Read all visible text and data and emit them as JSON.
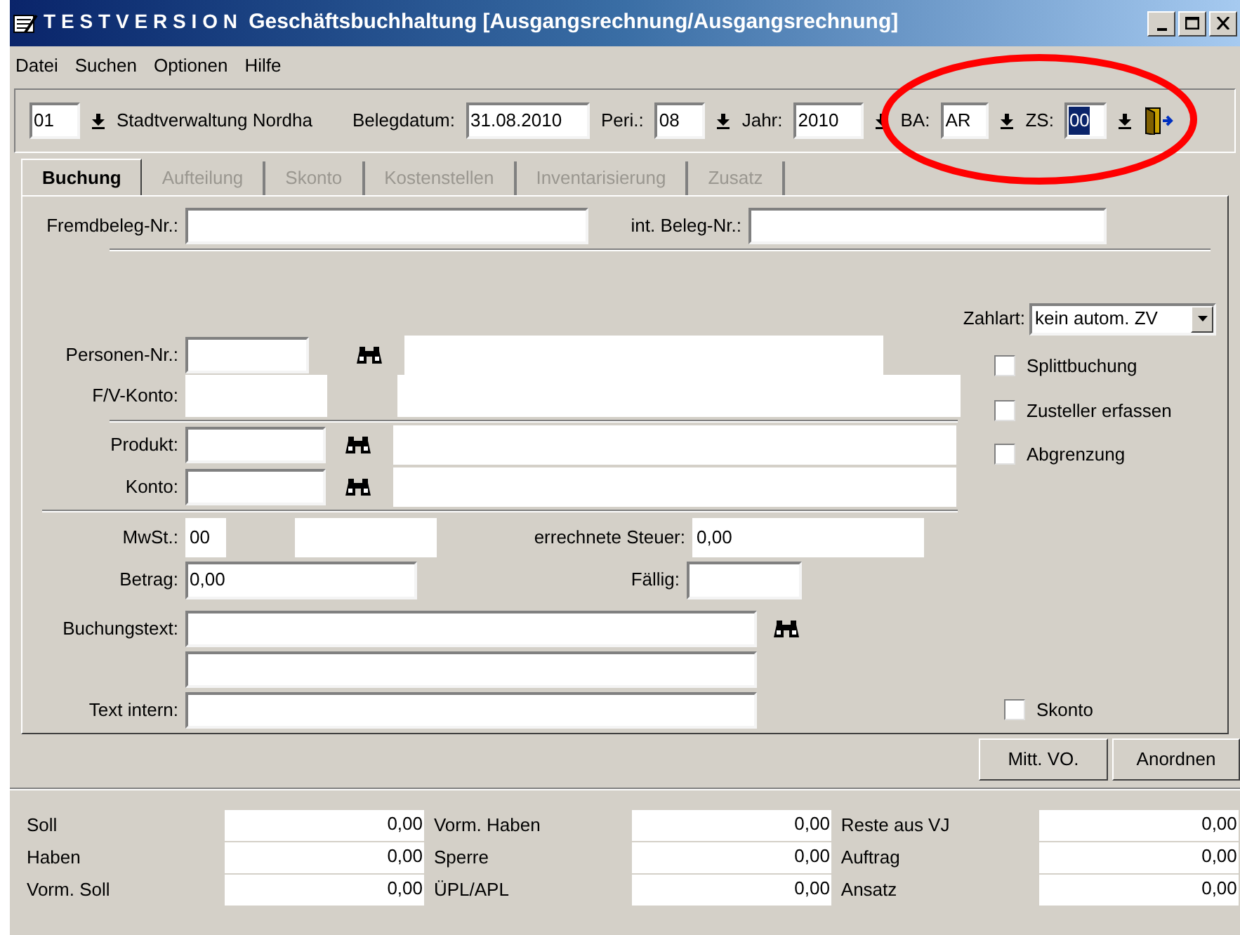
{
  "window": {
    "brand": "TESTVERSION",
    "title": "Geschäftsbuchhaltung [Ausgangsrechnung/Ausgangsrechnung]"
  },
  "menu": [
    "Datei",
    "Suchen",
    "Optionen",
    "Hilfe"
  ],
  "toolbar": {
    "mandant": "01",
    "mandant_name": "Stadtverwaltung Nordha",
    "fields": [
      {
        "label": "Belegdatum:",
        "value": "31.08.2010",
        "arrow": false,
        "focused": false
      },
      {
        "label": "Peri.:",
        "value": "08",
        "arrow": true,
        "focused": false
      },
      {
        "label": "Jahr:",
        "value": "2010",
        "arrow": true,
        "focused": false
      },
      {
        "label": "BA:",
        "value": "AR",
        "arrow": true,
        "focused": false
      },
      {
        "label": "ZS:",
        "value": "00",
        "arrow": true,
        "focused": true
      }
    ]
  },
  "annotation": {
    "kind": "ellipse",
    "color": "#ff0000"
  },
  "tabs": [
    {
      "label": "Buchung",
      "selected": true,
      "disabled": false
    },
    {
      "label": "Aufteilung",
      "selected": false,
      "disabled": true
    },
    {
      "label": "Skonto",
      "selected": false,
      "disabled": true
    },
    {
      "label": "Kostenstellen",
      "selected": false,
      "disabled": true
    },
    {
      "label": "Inventarisierung",
      "selected": false,
      "disabled": true
    },
    {
      "label": "Zusatz",
      "selected": false,
      "disabled": true
    }
  ],
  "form": {
    "fremdbeleg": {
      "label": "Fremdbeleg-Nr.:",
      "kind": "edit"
    },
    "int_beleg": {
      "label": "int. Beleg-Nr.:",
      "kind": "edit"
    },
    "zahlart": {
      "label": "Zahlart:",
      "value": "kein autom. ZV"
    },
    "personen": {
      "label": "Personen-Nr.:",
      "kind": "edit"
    },
    "fv_konto": {
      "label": "F/V-Konto:",
      "kind": "readonly"
    },
    "produkt": {
      "label": "Produkt:",
      "kind": "edit"
    },
    "konto": {
      "label": "Konto:",
      "kind": "edit"
    },
    "mwst": {
      "label": "MwSt.:",
      "value": "00",
      "kind": "readonly"
    },
    "steuer": {
      "label": "errechnete Steuer:",
      "value": "0,00",
      "kind": "readonly"
    },
    "betrag": {
      "label": "Betrag:",
      "value": "0,00",
      "kind": "edit"
    },
    "faellig": {
      "label": "Fällig:",
      "kind": "edit"
    },
    "buchungstext": {
      "label": "Buchungstext:",
      "kind": "edit"
    },
    "text_intern": {
      "label": "Text intern:",
      "kind": "edit"
    }
  },
  "checkboxes": [
    {
      "label": "Splittbuchung",
      "checked": false
    },
    {
      "label": "Zusteller erfassen",
      "checked": false
    },
    {
      "label": "Abgrenzung",
      "checked": false
    },
    {
      "label": "Skonto",
      "checked": false
    }
  ],
  "buttons": [
    "Mitt. VO.",
    "Anordnen"
  ],
  "totals": [
    [
      {
        "label": "Soll",
        "value": "0,00"
      },
      {
        "label": "Haben",
        "value": "0,00"
      },
      {
        "label": "Vorm. Soll",
        "value": "0,00"
      }
    ],
    [
      {
        "label": "Vorm. Haben",
        "value": "0,00"
      },
      {
        "label": "Sperre",
        "value": "0,00"
      },
      {
        "label": "ÜPL/APL",
        "value": "0,00"
      }
    ],
    [
      {
        "label": "Reste aus VJ",
        "value": "0,00"
      },
      {
        "label": "Auftrag",
        "value": "0,00"
      },
      {
        "label": "Ansatz",
        "value": "0,00"
      }
    ]
  ]
}
